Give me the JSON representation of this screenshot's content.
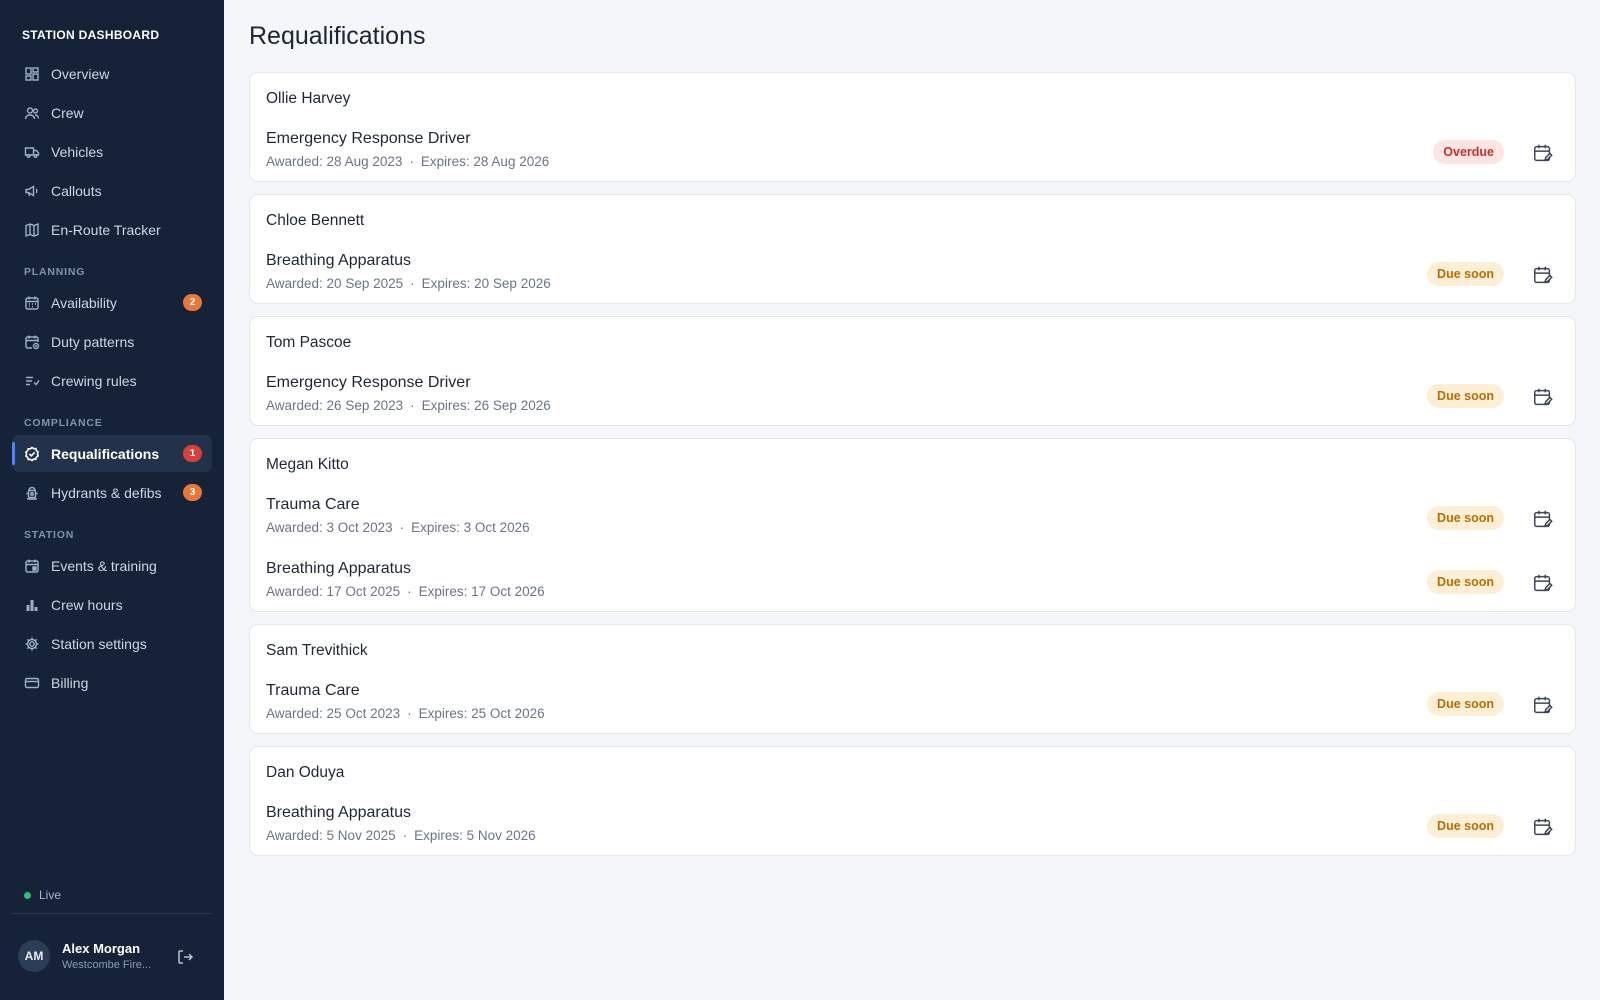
{
  "sidebar": {
    "brand": "STATION DASHBOARD",
    "items_main": [
      {
        "label": "Overview",
        "icon": "dashboard-icon"
      },
      {
        "label": "Crew",
        "icon": "users-icon"
      },
      {
        "label": "Vehicles",
        "icon": "truck-icon"
      },
      {
        "label": "Callouts",
        "icon": "megaphone-icon"
      },
      {
        "label": "En-Route Tracker",
        "icon": "map-icon"
      }
    ],
    "planning_label": "PLANNING",
    "items_planning": [
      {
        "label": "Availability",
        "icon": "calendar-icon",
        "badge": "2"
      },
      {
        "label": "Duty patterns",
        "icon": "calendar-clock-icon"
      },
      {
        "label": "Crewing rules",
        "icon": "list-check-icon"
      }
    ],
    "compliance_label": "COMPLIANCE",
    "items_compliance": [
      {
        "label": "Requalifications",
        "icon": "badge-check-icon",
        "badge": "1",
        "active": true
      },
      {
        "label": "Hydrants & defibs",
        "icon": "hydrant-icon",
        "badge": "3"
      }
    ],
    "station_label": "STATION",
    "items_station": [
      {
        "label": "Events & training",
        "icon": "calendar-event-icon"
      },
      {
        "label": "Crew hours",
        "icon": "bar-chart-icon"
      },
      {
        "label": "Station settings",
        "icon": "gear-icon"
      },
      {
        "label": "Billing",
        "icon": "credit-card-icon"
      }
    ],
    "status": "Live",
    "user": {
      "initials": "AM",
      "name": "Alex Morgan",
      "org": "Westcombe Fire..."
    }
  },
  "main": {
    "title": "Requalifications",
    "awarded_prefix": "Awarded: ",
    "expires_prefix": "Expires: ",
    "separator": "·",
    "people": [
      {
        "name": "Ollie Harvey",
        "quals": [
          {
            "name": "Emergency Response Driver",
            "awarded": "28 Aug 2023",
            "expires": "28 Aug 2026",
            "status": "Overdue",
            "kind": "overdue"
          }
        ]
      },
      {
        "name": "Chloe Bennett",
        "quals": [
          {
            "name": "Breathing Apparatus",
            "awarded": "20 Sep 2025",
            "expires": "20 Sep 2026",
            "status": "Due soon",
            "kind": "due"
          }
        ]
      },
      {
        "name": "Tom Pascoe",
        "quals": [
          {
            "name": "Emergency Response Driver",
            "awarded": "26 Sep 2023",
            "expires": "26 Sep 2026",
            "status": "Due soon",
            "kind": "due"
          }
        ]
      },
      {
        "name": "Megan Kitto",
        "quals": [
          {
            "name": "Trauma Care",
            "awarded": "3 Oct 2023",
            "expires": "3 Oct 2026",
            "status": "Due soon",
            "kind": "due"
          },
          {
            "name": "Breathing Apparatus",
            "awarded": "17 Oct 2025",
            "expires": "17 Oct 2026",
            "status": "Due soon",
            "kind": "due"
          }
        ]
      },
      {
        "name": "Sam Trevithick",
        "quals": [
          {
            "name": "Trauma Care",
            "awarded": "25 Oct 2023",
            "expires": "25 Oct 2026",
            "status": "Due soon",
            "kind": "due"
          }
        ]
      },
      {
        "name": "Dan Oduya",
        "quals": [
          {
            "name": "Breathing Apparatus",
            "awarded": "5 Nov 2025",
            "expires": "5 Nov 2026",
            "status": "Due soon",
            "kind": "due"
          }
        ]
      }
    ]
  },
  "colors": {
    "sidebar_bg": "#152238",
    "accent": "#4a86ff",
    "overdue": "#c2332b",
    "due_soon": "#b86e07",
    "live": "#34c06c"
  }
}
